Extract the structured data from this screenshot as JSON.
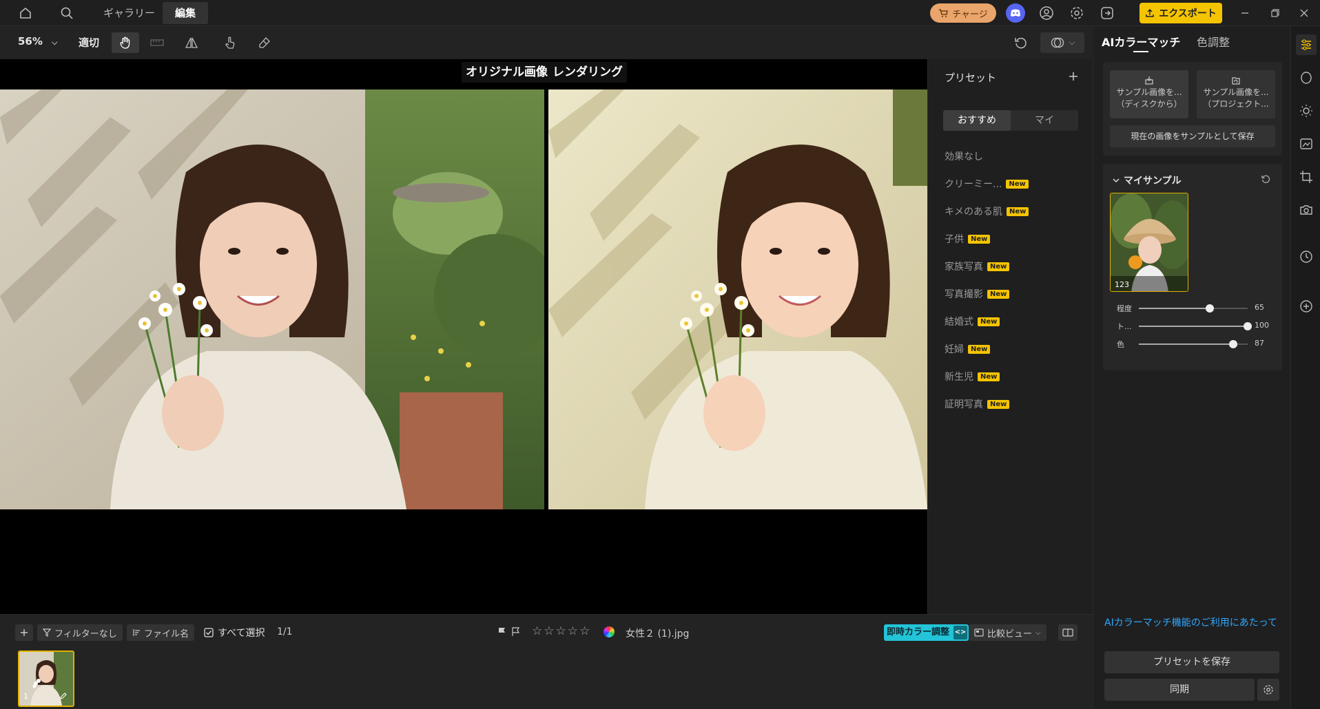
{
  "titlebar": {
    "tabs": [
      {
        "label": "ギャラリー"
      },
      {
        "label": "編集"
      }
    ],
    "charge_label": "チャージ",
    "export_label": "エクスポート"
  },
  "toolbar": {
    "zoom": "56%",
    "fit_label": "適切"
  },
  "canvas": {
    "original_label": "オリジナル画像",
    "rendered_label": "レンダリング"
  },
  "presets": {
    "title": "プリセット",
    "tabs": [
      {
        "label": "おすすめ"
      },
      {
        "label": "マイ"
      }
    ],
    "new_badge": "New",
    "items": [
      {
        "label": "効果なし"
      },
      {
        "label": "クリーミー..."
      },
      {
        "label": "キメのある肌"
      },
      {
        "label": "子供"
      },
      {
        "label": "家族写真"
      },
      {
        "label": "写真撮影"
      },
      {
        "label": "結婚式"
      },
      {
        "label": "妊婦"
      },
      {
        "label": "新生児"
      },
      {
        "label": "証明写真"
      }
    ]
  },
  "right_panel": {
    "tabs": [
      {
        "label": "AIカラーマッチ"
      },
      {
        "label": "色調整"
      }
    ],
    "sample_disk_line1": "サンプル画像を...",
    "sample_disk_line2": "（ディスクから）",
    "sample_project_line1": "サンプル画像を...",
    "sample_project_line2": "（プロジェクト...",
    "save_sample_label": "現在の画像をサンプルとして保存",
    "my_sample_title": "マイサンプル",
    "sample_name": "123",
    "sliders": [
      {
        "label": "程度",
        "value": 65
      },
      {
        "label": "ト...",
        "value": 100
      },
      {
        "label": "色",
        "value": 87
      }
    ],
    "ai_link": "AIカラーマッチ機能のご利用にあたって",
    "save_preset_label": "プリセットを保存",
    "sync_label": "同期"
  },
  "bottombar": {
    "filter_label": "フィルターなし",
    "sort_label": "ファイル名",
    "select_all_label": "すべて選択",
    "page_count": "1/1",
    "filename": "女性２ (1).jpg",
    "live_color_label": "即時カラー調整",
    "compare_view_label": "比較ビュー",
    "thumb_index": "1"
  },
  "colors": {
    "accent_yellow": "#f5c400",
    "charge_orange": "#e9a56b",
    "discord": "#5865f2",
    "live_color_cyan": "#23c4d8",
    "link_blue": "#2ea8ff"
  }
}
